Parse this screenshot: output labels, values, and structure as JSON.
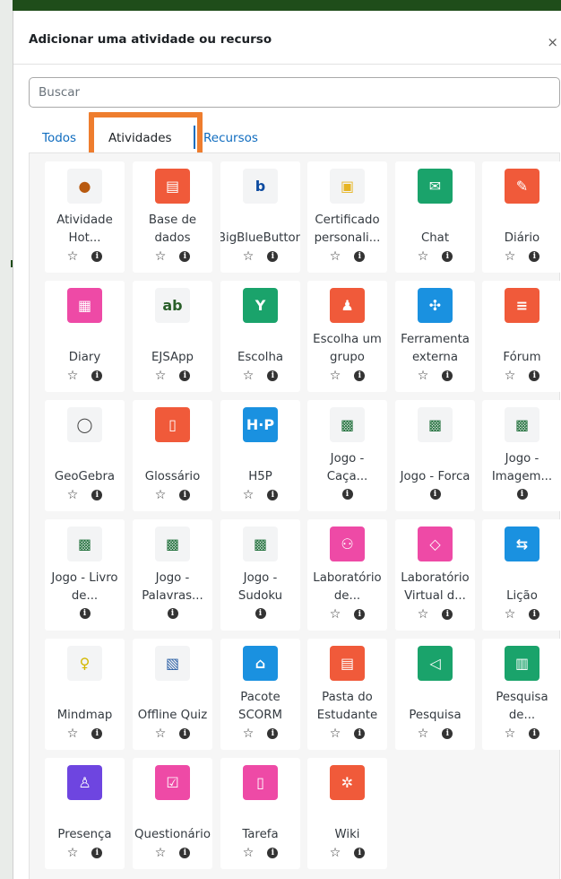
{
  "dialog": {
    "title": "Adicionar uma atividade ou recurso",
    "close_glyph": "×"
  },
  "search": {
    "placeholder": "Buscar"
  },
  "tabs": [
    {
      "label": "Todos",
      "active": false
    },
    {
      "label": "Atividades",
      "active": true
    },
    {
      "label": "Recursos",
      "active": false
    }
  ],
  "colors": {
    "accent_link": "#0f6cbf",
    "highlight_border": "#ee7d2e",
    "header_bar": "#1f4d1a"
  },
  "items": [
    {
      "name": "Atividade Hot...",
      "icon": "hotpot-icon",
      "color": "light",
      "glyph": "●",
      "glyph_color": "#b85a10",
      "star": true
    },
    {
      "name": "Base de dados",
      "icon": "database-icon",
      "color": "#f05a3a",
      "glyph": "▤",
      "star": true
    },
    {
      "name": "BigBlueButton",
      "icon": "bigbluebutton-icon",
      "color": "light",
      "glyph": "b",
      "glyph_color": "#0d4ba0",
      "star": true
    },
    {
      "name": "Certificado personali...",
      "icon": "certificate-icon",
      "color": "light",
      "glyph": "▣",
      "glyph_color": "#e6b422",
      "star": true
    },
    {
      "name": "Chat",
      "icon": "chat-icon",
      "color": "#1aa36b",
      "glyph": "✉",
      "star": true
    },
    {
      "name": "Diário",
      "icon": "journal-icon",
      "color": "#f05a3a",
      "glyph": "✎",
      "star": true
    },
    {
      "name": "Diary",
      "icon": "diary-icon",
      "color": "#ee4aa6",
      "glyph": "▦",
      "star": true
    },
    {
      "name": "EJSApp",
      "icon": "ejsapp-icon",
      "color": "light",
      "glyph": "ab",
      "glyph_color": "#2a5f2a",
      "star": true
    },
    {
      "name": "Escolha",
      "icon": "choice-icon",
      "color": "#1aa36b",
      "glyph": "Y",
      "star": true
    },
    {
      "name": "Escolha um grupo",
      "icon": "group-choice-icon",
      "color": "#f05a3a",
      "glyph": "♟",
      "star": true
    },
    {
      "name": "Ferramenta externa",
      "icon": "external-tool-icon",
      "color": "#1a91e0",
      "glyph": "✣",
      "star": true
    },
    {
      "name": "Fórum",
      "icon": "forum-icon",
      "color": "#f05a3a",
      "glyph": "≡",
      "star": true
    },
    {
      "name": "GeoGebra",
      "icon": "geogebra-icon",
      "color": "light",
      "glyph": "◯",
      "glyph_color": "#444",
      "star": true
    },
    {
      "name": "Glossário",
      "icon": "glossary-icon",
      "color": "#f05a3a",
      "glyph": "▯",
      "star": true
    },
    {
      "name": "H5P",
      "icon": "h5p-icon",
      "color": "#1a91e0",
      "glyph": "H·P",
      "star": true
    },
    {
      "name": "Jogo - Caça...",
      "icon": "game-icon",
      "color": "light",
      "glyph": "▩",
      "glyph_color": "#1f6f3a",
      "star": false
    },
    {
      "name": "Jogo - Forca",
      "icon": "game-icon",
      "color": "light",
      "glyph": "▩",
      "glyph_color": "#1f6f3a",
      "star": false
    },
    {
      "name": "Jogo - Imagem...",
      "icon": "game-icon",
      "color": "light",
      "glyph": "▩",
      "glyph_color": "#1f6f3a",
      "star": false
    },
    {
      "name": "Jogo - Livro de...",
      "icon": "game-icon",
      "color": "light",
      "glyph": "▩",
      "glyph_color": "#1f6f3a",
      "star": false
    },
    {
      "name": "Jogo - Palavras...",
      "icon": "game-icon",
      "color": "light",
      "glyph": "▩",
      "glyph_color": "#1f6f3a",
      "star": false
    },
    {
      "name": "Jogo - Sudoku",
      "icon": "game-icon",
      "color": "light",
      "glyph": "▩",
      "glyph_color": "#1f6f3a",
      "star": false
    },
    {
      "name": "Laboratório de...",
      "icon": "workshop-icon",
      "color": "#ee4aa6",
      "glyph": "⚇",
      "star": true
    },
    {
      "name": "Laboratório Virtual d...",
      "icon": "virtual-lab-icon",
      "color": "#ee4aa6",
      "glyph": "◇",
      "star": true
    },
    {
      "name": "Lição",
      "icon": "lesson-icon",
      "color": "#1a91e0",
      "glyph": "⇆",
      "star": true
    },
    {
      "name": "Mindmap",
      "icon": "mindmap-icon",
      "color": "light",
      "glyph": "♀",
      "glyph_color": "#d4b800",
      "star": true
    },
    {
      "name": "Offline Quiz",
      "icon": "offline-quiz-icon",
      "color": "light",
      "glyph": "▧",
      "glyph_color": "#2b5fa5",
      "star": true
    },
    {
      "name": "Pacote SCORM",
      "icon": "scorm-icon",
      "color": "#1a91e0",
      "glyph": "⌂",
      "star": true
    },
    {
      "name": "Pasta do Estudante",
      "icon": "student-folder-icon",
      "color": "#f05a3a",
      "glyph": "▤",
      "star": true
    },
    {
      "name": "Pesquisa",
      "icon": "feedback-icon",
      "color": "#1aa36b",
      "glyph": "◁",
      "star": true
    },
    {
      "name": "Pesquisa de...",
      "icon": "survey-icon",
      "color": "#1aa36b",
      "glyph": "▥",
      "star": true
    },
    {
      "name": "Presença",
      "icon": "attendance-icon",
      "color": "#6e45e0",
      "glyph": "♙",
      "star": true
    },
    {
      "name": "Questionário",
      "icon": "quiz-icon",
      "color": "#ee4aa6",
      "glyph": "☑",
      "star": true
    },
    {
      "name": "Tarefa",
      "icon": "assignment-icon",
      "color": "#ee4aa6",
      "glyph": "▯",
      "star": true
    },
    {
      "name": "Wiki",
      "icon": "wiki-icon",
      "color": "#f05a3a",
      "glyph": "✲",
      "star": true
    }
  ]
}
